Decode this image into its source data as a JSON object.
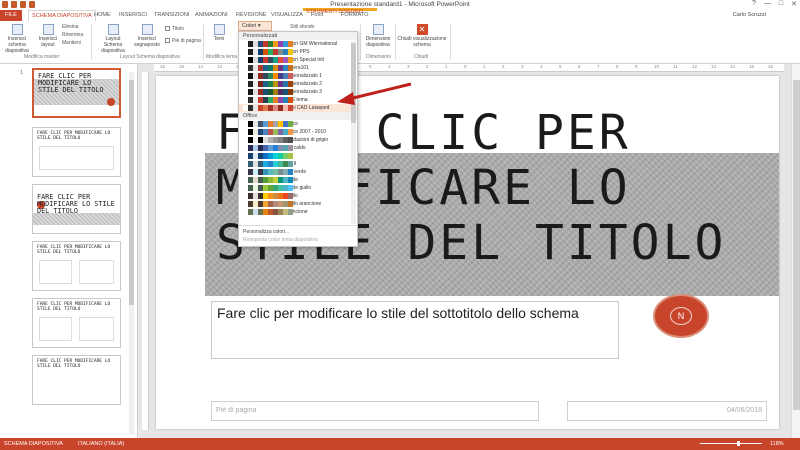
{
  "window": {
    "title": "Presentazione standard1 - Microsoft PowerPoint",
    "user": "Carlo Scruzzi",
    "controls": [
      "?",
      "—",
      "□",
      "✕"
    ]
  },
  "tools_context": "STRUMENTI DISEGNO",
  "tabs": [
    "FILE",
    "SCHEMA DIAPOSITIVA",
    "HOME",
    "INSERISCI",
    "TRANSIZIONI",
    "ANIMAZIONI",
    "REVISIONE",
    "VISUALIZZA",
    "Foxit",
    "FORMATO"
  ],
  "ribbon": {
    "insert_master": "Inserisci schema diapositiva",
    "insert_layout": "Inserisci layout",
    "delete": "Elimina",
    "rename": "Rinomina",
    "preserve": "Mantieni",
    "layout_master": "Layout Schema diapositiva",
    "insert_placeholder": "Inserisci segnaposto",
    "title_check": "Titolo",
    "footer_check": "Piè di pagina",
    "themes": "Temi",
    "colors": "Colori",
    "background_styles": "Stili sfondo",
    "slide_size": "Dimensioni diapositiva",
    "close_master": "Chiudi visualizzazione schema",
    "groups": [
      "Modifica master",
      "Layout Schema diapositiva",
      "Modifica tema",
      "Dimensioni",
      "Chiudi"
    ]
  },
  "colors_dropdown": {
    "section_custom": "Personalizzati",
    "custom": [
      {
        "label": "Colori GM Wternational",
        "swatch": [
          "#ffffff",
          "#1f1f1f",
          "#e0e0e0",
          "#2b4a7a",
          "#c0392b",
          "#2e7d32",
          "#f39c12",
          "#8e44ad",
          "#3498db",
          "#e67e22"
        ]
      },
      {
        "label": "Colori PPS",
        "swatch": [
          "#ffffff",
          "#202020",
          "#eaeaea",
          "#163a6b",
          "#d35400",
          "#27ae60",
          "#c0392b",
          "#7f8c8d",
          "#2980b9",
          "#f1c40f"
        ]
      },
      {
        "label": "Colori Special Intl",
        "swatch": [
          "#ffffff",
          "#000000",
          "#dddddd",
          "#1a3c6e",
          "#c0392b",
          "#34495e",
          "#16a085",
          "#e74c3c",
          "#9b59b6",
          "#f39c12"
        ]
      },
      {
        "label": "Lettera101",
        "swatch": [
          "#ffffff",
          "#333333",
          "#e5e5e5",
          "#b03a2e",
          "#1f618d",
          "#117a65",
          "#d68910",
          "#6c3483",
          "#2e86c1",
          "#ca6f1e"
        ]
      },
      {
        "label": "Personalizzato 1",
        "swatch": [
          "#ffffff",
          "#111111",
          "#e8e8e8",
          "#8b2b1d",
          "#34495e",
          "#2e8b57",
          "#ff8c00",
          "#483d8b",
          "#4682b4",
          "#cd5c5c"
        ]
      },
      {
        "label": "Personalizzato 2",
        "swatch": [
          "#ffffff",
          "#222222",
          "#eeeeee",
          "#7b241c",
          "#21618c",
          "#1e8449",
          "#b7950b",
          "#6c3483",
          "#2874a6",
          "#a04000"
        ]
      },
      {
        "label": "Personalizzato 3",
        "swatch": [
          "#ffffff",
          "#151515",
          "#e0e0e0",
          "#922b21",
          "#1b4f72",
          "#145a32",
          "#9a7d0a",
          "#512e5f",
          "#1a5276",
          "#873600"
        ]
      },
      {
        "label": "PPS tema",
        "swatch": [
          "#ffffff",
          "#2c2c2c",
          "#efefef",
          "#c0392b",
          "#2c3e50",
          "#27ae60",
          "#e67e22",
          "#8e44ad",
          "#2980b9",
          "#d35400"
        ]
      },
      {
        "label": "Temi CAD Latasped",
        "swatch": [
          "#ffffff",
          "#303030",
          "#e6e6e6",
          "#c8452b",
          "#e07b4f",
          "#a93226",
          "#d98880",
          "#922b21",
          "#f5b7b1",
          "#cb4335"
        ]
      }
    ],
    "section_office": "Office",
    "office": [
      {
        "label": "Office",
        "swatch": [
          "#ffffff",
          "#000000",
          "#e7e6e6",
          "#44546a",
          "#5b9bd5",
          "#ed7d31",
          "#a5a5a5",
          "#ffc000",
          "#4472c4",
          "#70ad47"
        ]
      },
      {
        "label": "Office 2007 - 2010",
        "swatch": [
          "#ffffff",
          "#000000",
          "#eeece1",
          "#1f497d",
          "#4f81bd",
          "#c0504d",
          "#9bbb59",
          "#8064a2",
          "#4bacc6",
          "#f79646"
        ]
      },
      {
        "label": "Gradazioni di grigio",
        "swatch": [
          "#ffffff",
          "#000000",
          "#f8f8f8",
          "#000000",
          "#dddddd",
          "#b2b2b2",
          "#969696",
          "#808080",
          "#5f5f5f",
          "#4d4d4d"
        ]
      },
      {
        "label": "Blu caldo",
        "swatch": [
          "#ffffff",
          "#242852",
          "#acccea",
          "#242852",
          "#4a66ac",
          "#629dd1",
          "#297fd5",
          "#7f8fa9",
          "#5aa2ae",
          "#9d90a0"
        ]
      },
      {
        "label": "Blu",
        "swatch": [
          "#ffffff",
          "#17406d",
          "#dbeff9",
          "#17406d",
          "#0f6fc6",
          "#009dd9",
          "#0bd0d9",
          "#10cf9b",
          "#7cca62",
          "#a5c249"
        ]
      },
      {
        "label": "Blu II",
        "swatch": [
          "#ffffff",
          "#335b74",
          "#dfe3e5",
          "#335b74",
          "#1cade4",
          "#2683c6",
          "#27ced7",
          "#42ba97",
          "#3e8853",
          "#62a39f"
        ]
      },
      {
        "label": "Blu verde",
        "swatch": [
          "#ffffff",
          "#373545",
          "#ceeff4",
          "#373545",
          "#3494ba",
          "#58b6c0",
          "#75bda7",
          "#7a8c8e",
          "#84acb6",
          "#2683c6"
        ]
      },
      {
        "label": "Verde",
        "swatch": [
          "#ffffff",
          "#455f51",
          "#e3ded1",
          "#455f51",
          "#549e39",
          "#8ab833",
          "#c0cf3a",
          "#029676",
          "#4ab5c4",
          "#0989b1"
        ]
      },
      {
        "label": "Verde giallo",
        "swatch": [
          "#ffffff",
          "#455f51",
          "#ebf4dc",
          "#455f51",
          "#99cb38",
          "#63a537",
          "#37a76f",
          "#44c1a3",
          "#4eb3cf",
          "#51c3f9"
        ]
      },
      {
        "label": "Giallo",
        "swatch": [
          "#ffffff",
          "#39302a",
          "#e5dedb",
          "#39302a",
          "#ffca08",
          "#f8931d",
          "#ce8d3e",
          "#ec7016",
          "#e64823",
          "#9c6a6a"
        ]
      },
      {
        "label": "Giallo arancione",
        "swatch": [
          "#ffffff",
          "#4e3b30",
          "#fbeec9",
          "#4e3b30",
          "#f0a22e",
          "#a5644e",
          "#b58b80",
          "#c3986d",
          "#a19574",
          "#c17529"
        ]
      },
      {
        "label": "Arancione",
        "swatch": [
          "#ffffff",
          "#637052",
          "#ccddea",
          "#637052",
          "#e48312",
          "#bd582c",
          "#865640",
          "#9b8357",
          "#c2bc80",
          "#94a088"
        ]
      }
    ],
    "customize": "Personalizza colori...",
    "reset": "Reimposta colori tema diapositiva"
  },
  "thumbnails": [
    {
      "num": "1",
      "title": "FARE CLIC PER MODIFICARE LO STILE DEL TITOLO",
      "selected": true
    },
    {
      "num": "",
      "title": "FARE CLIC PER MODIFICARE LO STILE DEL TITOLO"
    },
    {
      "num": "",
      "title": "FARE CLIC PER MODIFICARE LO STILE DEL TITOLO"
    },
    {
      "num": "",
      "title": "FARE CLIC PER MODIFICARE LO STILE DEL TITOLO"
    },
    {
      "num": "",
      "title": "FARE CLIC PER MODIFICARE LO STILE DEL TITOLO"
    },
    {
      "num": "",
      "title": "FARE CLIC PER MODIFICARE LO STILE DEL TITOLO"
    }
  ],
  "slide": {
    "title": "FARE CLIC PER MODIFICARE LO STILE DEL TITOLO",
    "subtitle": "Fare clic per modificare lo stile del sottotitolo dello schema",
    "footer": "Piè di pagina",
    "date": "04/06/2018",
    "logo_letter": "N"
  },
  "ruler_marks": [
    "16",
    "15",
    "14",
    "13",
    "12",
    "11",
    "10",
    "9",
    "8",
    "7",
    "6",
    "5",
    "4",
    "3",
    "2",
    "1",
    "0",
    "1",
    "2",
    "3",
    "4",
    "5",
    "6",
    "7",
    "8",
    "9",
    "10",
    "11",
    "12",
    "13",
    "14",
    "15",
    "16"
  ],
  "status": {
    "view": "SCHEMA DIAPOSITIVA",
    "language": "ITALIANO (ITALIA)",
    "zoom": "118%",
    "zoom_fraction": 0.6
  },
  "colors": {
    "accent": "#c8452b",
    "arrow": "#c0201a"
  }
}
